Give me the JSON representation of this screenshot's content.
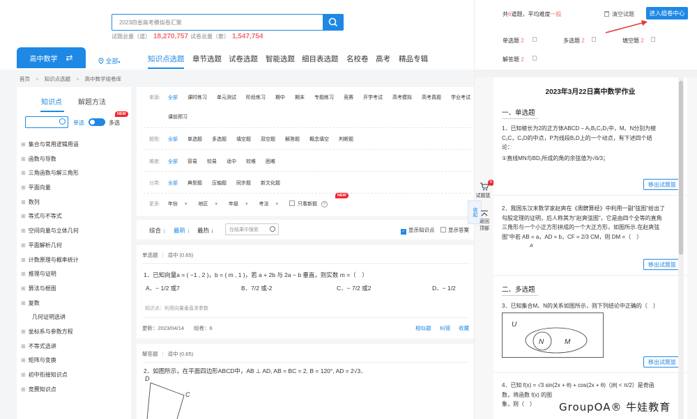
{
  "search": {
    "value": "2023四省高考模拟卷汇聚"
  },
  "stats": {
    "questions_label": "试题总量（道）",
    "questions_value": "18,270,757",
    "papers_label": "试卷总量（套）",
    "papers_value": "1,547,754"
  },
  "grade": {
    "label": "高中数学",
    "swap": "⇄"
  },
  "location": {
    "label": "全部"
  },
  "nav": [
    "知识点选题",
    "章节选题",
    "试卷选题",
    "智能选题",
    "细目表选题",
    "名校卷",
    "高考",
    "精品专辑"
  ],
  "breadcrumb": [
    "首页",
    "知识点选题",
    "高中数学组卷库"
  ],
  "sidebar": {
    "tabs": [
      "知识点",
      "解题方法"
    ],
    "single": "单选",
    "multi": "多选",
    "new": "NEW",
    "tree": [
      "集合与常用逻辑用语",
      "函数与导数",
      "三角函数与解三角形",
      "平面向量",
      "数列",
      "等式与不等式",
      "空间向量与立体几何",
      "平面解析几何",
      "计数原理与概率统计",
      "推理与证明",
      "算法与框图",
      "复数",
      "几何证明选讲",
      "坐标系与参数方程",
      "不等式选讲",
      "矩阵与变换",
      "初中衔接知识点",
      "竞赛知识点"
    ]
  },
  "filters": {
    "source": {
      "label": "来源:",
      "options": [
        "全部",
        "课时练习",
        "单元测试",
        "阶段练习",
        "期中",
        "期末",
        "专题练习",
        "竞赛",
        "开学考试",
        "高考模拟",
        "高考真题",
        "学业考试",
        "课前预习"
      ]
    },
    "type": {
      "label": "题型:",
      "options": [
        "全部",
        "单选题",
        "多选题",
        "填空题",
        "双空题",
        "解答题",
        "概念填空",
        "判断题"
      ]
    },
    "difficulty": {
      "label": "难度:",
      "options": [
        "全部",
        "容易",
        "较易",
        "适中",
        "较难",
        "困难"
      ]
    },
    "category": {
      "label": "分类:",
      "options": [
        "全部",
        "典型题",
        "压轴题",
        "同步题",
        "新文化题"
      ]
    },
    "more": {
      "label": "更多:",
      "options": [
        "年份",
        "地区",
        "年级",
        "考法"
      ],
      "checkbox": "只看新题",
      "new": "NEW"
    }
  },
  "sortbar": {
    "items": [
      "综合",
      "最新",
      "最热"
    ],
    "search_placeholder": "在结果中搜索",
    "show_knowledge": "显示知识点",
    "show_answer": "显示答案"
  },
  "q1": {
    "type": "单选题",
    "difficulty": "适中 (0.65)",
    "stem": "1．已知向量a = ( −1 , 2 )，b = ( m , 1 )，若 a + 2b 与 2a − b 垂直，则实数 m =（　）",
    "options": [
      "A．− 1/2 或7",
      "B．7/2 或-2",
      "C．− 7/2 或2",
      "D．− 1/2"
    ],
    "knowledge": "知识点：利用向量垂直求参数",
    "updated": "更新：2023/04/14",
    "count": "组卷：6",
    "actions": [
      "相似题",
      "纠错",
      "收藏"
    ]
  },
  "q2": {
    "type": "解答题",
    "difficulty": "适中 (0.65)",
    "stem": "2．如图所示，在平面四边形ABCD中，AB ⊥ AD, AB = BC = 2, B = 120°, AD = 2√3．",
    "labels": [
      "D",
      "C"
    ]
  },
  "right": {
    "summary_prefix": "共",
    "summary_count": "6",
    "summary_mid": "道题，平均难度",
    "summary_level": "一般",
    "clear": "清空试题",
    "assemble": "进入组卷中心",
    "counts": [
      {
        "label": "单选题",
        "n": "2"
      },
      {
        "label": "多选题",
        "n": "2"
      },
      {
        "label": "填空题",
        "n": "2"
      },
      {
        "label": "解答题",
        "n": "2"
      }
    ],
    "cart_label": "试题篮",
    "cart_count": "6",
    "collapse": "收起",
    "back_top": "返回顶部"
  },
  "paper": {
    "title": "2023年3月22日高中数学作业",
    "sec1": "一、单选题",
    "sec2": "二、多选题",
    "q1a": "1．已知棱长为2的正方体ABCD − A₁B₁C₁D₁中，M、N分别为棱",
    "q1b": "C₁C，C₁D的中点，P为线段B₁D上的一个动点，有下述四个结",
    "q1c": "论：",
    "q1d": "①直线MN与BD₁所成的角的余弦值为√6/3；",
    "q2a": "2．我国东汉末数学家赵爽在《周髀算经》中利用一副\"弦图\"给出了",
    "q2b": "勾股定理的证明，后人称其为\"赵爽弦图\"，它是由四个全等的直角",
    "q2c": "三角形与一个小正方形拼成的一个大正方形，如图所示.在赵爽弦",
    "q2d": "图\"中若 AB = a，AD = b，CF = 2/3 CM，则 DM =（　）",
    "q2e": "A",
    "q3": "3．已知集合M、N的关系如图所示，则下列结论中正确的（　）",
    "venn_u": "U",
    "venn_n": "N",
    "venn_m": "M",
    "q4a": "4．已知 f(x) = √3 sin(2x + θ) + cos(2x + θ)（|θ| < π/2）是奇函",
    "q4b": "数，将函数 f(x) 的图",
    "q4c": "象，则（　）",
    "remove": "移出试题篮"
  },
  "watermark": "GroupOA® 牛娃教育"
}
